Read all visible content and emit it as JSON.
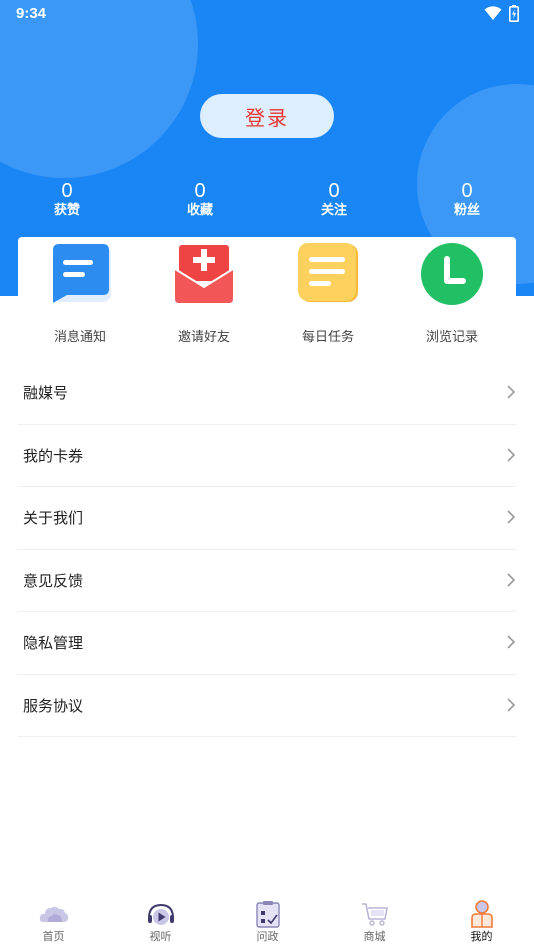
{
  "status_bar": {
    "time": "9:34"
  },
  "header": {
    "login_label": "登录"
  },
  "stats": [
    {
      "value": "0",
      "label": "获赞"
    },
    {
      "value": "0",
      "label": "收藏"
    },
    {
      "value": "0",
      "label": "关注"
    },
    {
      "value": "0",
      "label": "粉丝"
    }
  ],
  "quick_actions": [
    {
      "label": "消息通知",
      "icon": "message-icon",
      "color": "#2d8cf0"
    },
    {
      "label": "邀请好友",
      "icon": "invite-envelope-icon",
      "color": "#f04343"
    },
    {
      "label": "每日任务",
      "icon": "task-list-icon",
      "color": "#fbc545"
    },
    {
      "label": "浏览记录",
      "icon": "clock-icon",
      "color": "#22c064"
    }
  ],
  "menu": [
    {
      "label": "融媒号"
    },
    {
      "label": "我的卡券"
    },
    {
      "label": "关于我们"
    },
    {
      "label": "意见反馈"
    },
    {
      "label": "隐私管理"
    },
    {
      "label": "服务协议"
    }
  ],
  "tabs": [
    {
      "label": "首页",
      "icon": "home-cloud-icon"
    },
    {
      "label": "视听",
      "icon": "play-headphones-icon"
    },
    {
      "label": "问政",
      "icon": "clipboard-icon"
    },
    {
      "label": "商城",
      "icon": "cart-icon"
    },
    {
      "label": "我的",
      "icon": "person-icon",
      "active": true
    }
  ],
  "colors": {
    "header_blue": "#1a86f5",
    "login_text": "#e8362f",
    "tab_active": "#f07a3a"
  }
}
